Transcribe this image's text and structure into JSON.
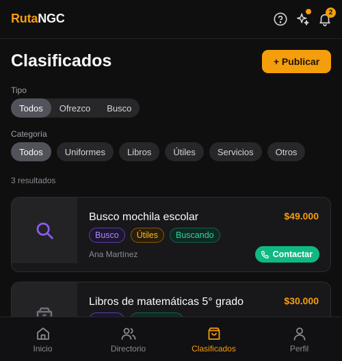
{
  "header": {
    "brand_accent": "Ruta",
    "brand_rest": "NGC",
    "notification_count": "2",
    "icons": [
      "help-circle-icon",
      "sparkles-icon",
      "bell-icon"
    ]
  },
  "page": {
    "title": "Clasificados",
    "publish_label": "+ Publicar"
  },
  "filters": {
    "tipo_label": "Tipo",
    "tipo_options": [
      "Todos",
      "Ofrezco",
      "Busco"
    ],
    "tipo_selected": "Todos",
    "categoria_label": "Categoría",
    "categoria_options": [
      "Todos",
      "Uniformes",
      "Libros",
      "Útiles",
      "Servicios",
      "Otros"
    ],
    "categoria_selected": "Todos"
  },
  "results_text": "3 resultados",
  "listings": [
    {
      "title": "Busco mochila escolar",
      "price": "$49.000",
      "tags": [
        "Busco",
        "Útiles",
        "Buscando"
      ],
      "author": "Ana Martínez",
      "contact_label": "Contactar",
      "icon": "search-icon"
    },
    {
      "title": "Libros de matemáticas 5° grado",
      "price": "$30.000",
      "icon": "package-icon"
    }
  ],
  "bottom_nav": [
    {
      "label": "Inicio",
      "icon": "home-icon"
    },
    {
      "label": "Directorio",
      "icon": "users-icon"
    },
    {
      "label": "Clasificados",
      "icon": "shopping-bag-icon",
      "active": true
    },
    {
      "label": "Perfil",
      "icon": "user-icon"
    }
  ],
  "colors": {
    "accent": "#f59e0b",
    "background": "#0f0f10",
    "success": "#10b981"
  }
}
